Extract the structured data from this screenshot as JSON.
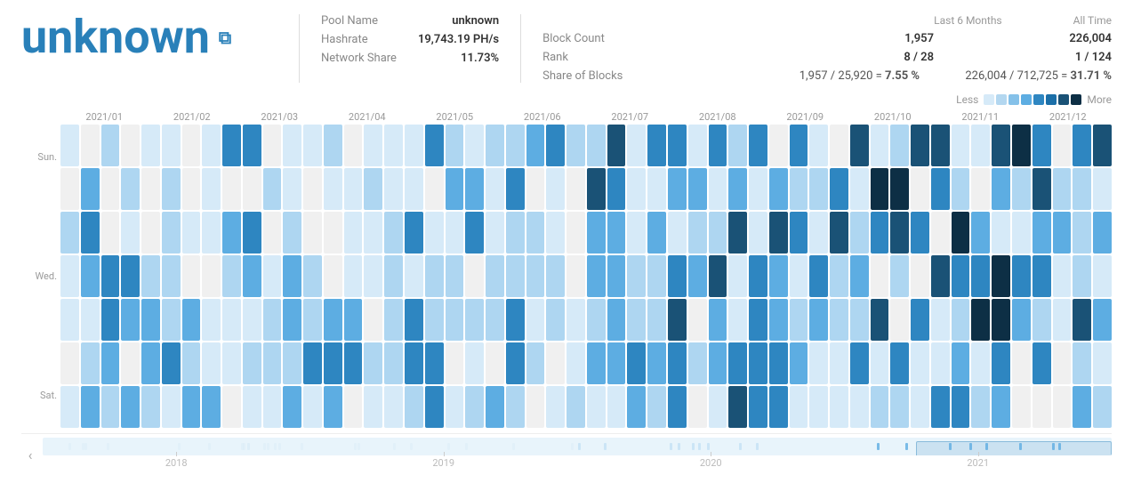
{
  "pool": {
    "name": "unknown",
    "external_link_label": "↗"
  },
  "stats_left": {
    "pool_name_label": "Pool Name",
    "pool_name_value": "unknown",
    "hashrate_label": "Hashrate",
    "hashrate_value": "19,743.19 PH/s",
    "network_share_label": "Network Share",
    "network_share_value": "11.73%"
  },
  "stats_right": {
    "last_6_months_label": "Last 6 Months",
    "all_time_label": "All Time",
    "block_count_label": "Block Count",
    "block_count_6m": "1,957",
    "block_count_all": "226,004",
    "rank_label": "Rank",
    "rank_6m": "8 / 28",
    "rank_all": "1 / 124",
    "share_of_blocks_label": "Share of Blocks",
    "share_6m_text": "1,957 / 25,920 = ",
    "share_6m_pct": "7.55 %",
    "share_all_text": "226,004 / 712,725 = ",
    "share_all_pct": "31.71 %"
  },
  "legend": {
    "less_label": "Less",
    "more_label": "More",
    "colors": [
      "#d6eaf8",
      "#aed6f1",
      "#85c1e9",
      "#5dade2",
      "#2e86c1",
      "#1a5276",
      "#0d2f45"
    ]
  },
  "heatmap": {
    "months": [
      "2021/01",
      "2021/02",
      "2021/03",
      "2021/04",
      "2021/05",
      "2021/06",
      "2021/07",
      "2021/08",
      "2021/09",
      "2021/10",
      "2021/11",
      "2021/12"
    ],
    "day_labels": [
      "Sun.",
      "",
      "Wed.",
      "",
      "Sat."
    ]
  },
  "timeline": {
    "years": [
      "2018",
      "2019",
      "2020",
      "2021"
    ],
    "nav_arrow": "‹"
  }
}
